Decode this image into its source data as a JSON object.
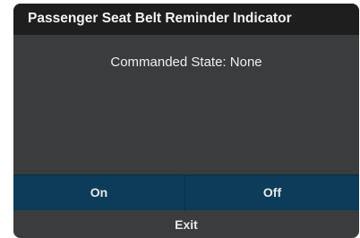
{
  "dialog": {
    "title": "Passenger Seat Belt Reminder Indicator",
    "message": "Commanded State: None",
    "actions": {
      "on_label": "On",
      "off_label": "Off"
    },
    "exit_label": "Exit"
  },
  "colors": {
    "title_bar": "#1e1e1e",
    "body": "#3a3c3d",
    "action_row": "#0c3c5a",
    "text": "#eeeeee"
  }
}
